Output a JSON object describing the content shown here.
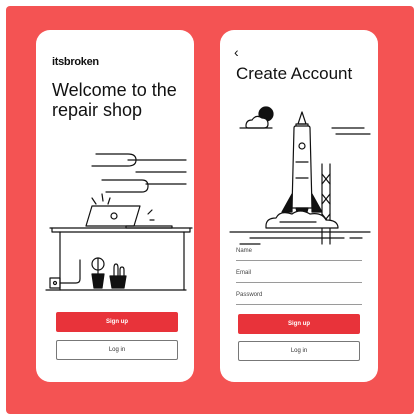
{
  "colors": {
    "background": "#f45353",
    "primary": "#e8333a",
    "phone": "#ffffff",
    "ink": "#111111"
  },
  "left_screen": {
    "logo": "itsbroken",
    "heading": "Welcome to the repair shop",
    "illustration": "laptop-on-desk-with-plants-icon",
    "signup_label": "Sign up",
    "login_label": "Log in"
  },
  "right_screen": {
    "back_icon": "chevron-left-icon",
    "heading": "Create Account",
    "illustration": "rocket-launch-icon",
    "fields": {
      "name": {
        "label": "Name",
        "value": ""
      },
      "email": {
        "label": "Email",
        "value": ""
      },
      "password": {
        "label": "Password",
        "value": ""
      }
    },
    "signup_label": "Sign up",
    "login_label": "Log in"
  }
}
